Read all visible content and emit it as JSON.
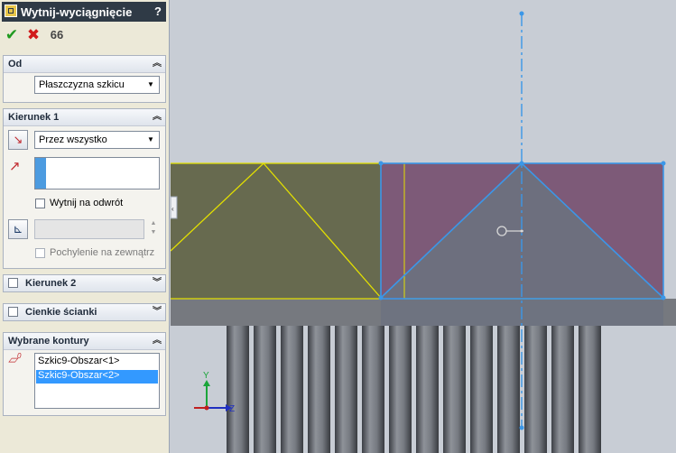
{
  "panel": {
    "title": "Wytnij-wyciągnięcie",
    "help": "?",
    "toolbar": {
      "ok": "✔",
      "cancel": "✖",
      "preview": "66"
    },
    "od": {
      "heading": "Od",
      "select_value": "Płaszczyzna szkicu"
    },
    "kierunek1": {
      "heading": "Kierunek 1",
      "end_condition": "Przez wszystko",
      "flip_label": "Wytnij na odwrót",
      "draft_outward_label": "Pochylenie na zewnątrz",
      "draft_value": ""
    },
    "kierunek2": {
      "heading": "Kierunek 2"
    },
    "thin": {
      "heading": "Cienkie ścianki"
    },
    "contours": {
      "heading": "Wybrane kontury",
      "items": [
        "Szkic9-Obszar<1>",
        "Szkic9-Obszar<2>"
      ],
      "selected_index": 1
    }
  },
  "triad": {
    "y": "Y",
    "z": "Z"
  },
  "colors": {
    "yellow_region": "#676a4f",
    "purple_region": "#7d5a78",
    "selection_blue": "#3b97e8",
    "sketch_yellow": "#e3e000",
    "title_bar": "#2f3a46",
    "list_selection": "#3399ff"
  }
}
